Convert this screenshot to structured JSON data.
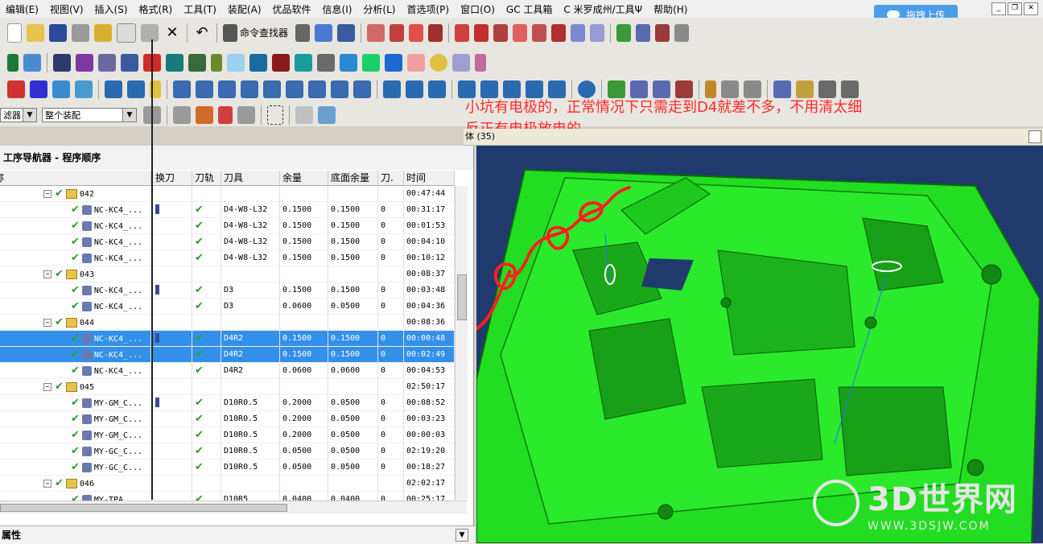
{
  "menu": [
    "编辑(E)",
    "视图(V)",
    "插入(S)",
    "格式(R)",
    "工具(T)",
    "装配(A)",
    "优品软件",
    "信息(I)",
    "分析(L)",
    "首选项(P)",
    "窗口(O)",
    "GC 工具箱",
    "C 米罗成州/工具Ψ",
    "帮助(H)"
  ],
  "upload_button": "拖拽上传",
  "toolbar": {
    "command_finder": "命令查找器"
  },
  "filter": {
    "label": "滤器",
    "assembly": "整个装配"
  },
  "annotation": [
    "小坑有电极的，正常情况下只需走到D4就差不多，不用清太细",
    "反正有电极放电的。"
  ],
  "graphics": {
    "title": "体 (35)"
  },
  "navigator": {
    "title": "工序导航器 - 程序顺序",
    "columns": [
      "名称",
      "换刀",
      "刀轨",
      "刀具",
      "余量",
      "底面余量",
      "刀.",
      "时间"
    ],
    "rows": [
      {
        "type": "group",
        "name": "042",
        "time": "00:47:44"
      },
      {
        "type": "op",
        "name": "NC-KC4_...",
        "tc": true,
        "path": true,
        "tool": "D4-W8-L32",
        "stock": "0.1500",
        "floor": "0.1500",
        "n": "0",
        "time": "00:31:17",
        "sel": false
      },
      {
        "type": "op",
        "name": "NC-KC4_...",
        "tc": false,
        "path": true,
        "tool": "D4-W8-L32",
        "stock": "0.1500",
        "floor": "0.1500",
        "n": "0",
        "time": "00:01:53",
        "sel": false
      },
      {
        "type": "op",
        "name": "NC-KC4_...",
        "tc": false,
        "path": true,
        "tool": "D4-W8-L32",
        "stock": "0.1500",
        "floor": "0.1500",
        "n": "0",
        "time": "00:04:10",
        "sel": false
      },
      {
        "type": "op",
        "name": "NC-KC4_...",
        "tc": false,
        "path": true,
        "tool": "D4-W8-L32",
        "stock": "0.1500",
        "floor": "0.1500",
        "n": "0",
        "time": "00:10:12",
        "sel": false
      },
      {
        "type": "group",
        "name": "043",
        "time": "00:08:37"
      },
      {
        "type": "op",
        "name": "NC-KC4_...",
        "tc": true,
        "path": true,
        "tool": "D3",
        "stock": "0.1500",
        "floor": "0.1500",
        "n": "0",
        "time": "00:03:48",
        "sel": false
      },
      {
        "type": "op",
        "name": "NC-KC4_...",
        "tc": false,
        "path": true,
        "tool": "D3",
        "stock": "0.0600",
        "floor": "0.0500",
        "n": "0",
        "time": "00:04:36",
        "sel": false
      },
      {
        "type": "group",
        "name": "044",
        "time": "00:08:36"
      },
      {
        "type": "op",
        "name": "NC-KC4_...",
        "tc": true,
        "path": true,
        "tool": "D4R2",
        "stock": "0.1500",
        "floor": "0.1500",
        "n": "0",
        "time": "00:00:48",
        "sel": true
      },
      {
        "type": "op",
        "name": "NC-KC4_...",
        "tc": false,
        "path": true,
        "tool": "D4R2",
        "stock": "0.1500",
        "floor": "0.1500",
        "n": "0",
        "time": "00:02:49",
        "sel": true
      },
      {
        "type": "op",
        "name": "NC-KC4_...",
        "tc": false,
        "path": true,
        "tool": "D4R2",
        "stock": "0.0600",
        "floor": "0.0600",
        "n": "0",
        "time": "00:04:53",
        "sel": false
      },
      {
        "type": "group",
        "name": "045",
        "time": "02:50:17"
      },
      {
        "type": "op",
        "name": "MY-GM_C...",
        "tc": true,
        "path": true,
        "tool": "D10R0.5",
        "stock": "0.2000",
        "floor": "0.0500",
        "n": "0",
        "time": "00:08:52",
        "sel": false
      },
      {
        "type": "op",
        "name": "MY-GM_C...",
        "tc": false,
        "path": true,
        "tool": "D10R0.5",
        "stock": "0.2000",
        "floor": "0.0500",
        "n": "0",
        "time": "00:03:23",
        "sel": false
      },
      {
        "type": "op",
        "name": "MY-GM_C...",
        "tc": false,
        "path": true,
        "tool": "D10R0.5",
        "stock": "0.2000",
        "floor": "0.0500",
        "n": "0",
        "time": "00:00:03",
        "sel": false
      },
      {
        "type": "op",
        "name": "MY-GC_C...",
        "tc": false,
        "path": true,
        "tool": "D10R0.5",
        "stock": "0.0500",
        "floor": "0.0500",
        "n": "0",
        "time": "02:19:20",
        "sel": false
      },
      {
        "type": "op",
        "name": "MY-GC_C...",
        "tc": false,
        "path": true,
        "tool": "D10R0.5",
        "stock": "0.0500",
        "floor": "0.0500",
        "n": "0",
        "time": "00:18:27",
        "sel": false
      },
      {
        "type": "group",
        "name": "046",
        "time": "02:02:17"
      },
      {
        "type": "op",
        "name": "MY-TPA",
        "tc": false,
        "path": true,
        "tool": "D10R5",
        "stock": "0.0400",
        "floor": "0.0400",
        "n": "0",
        "time": "00:25:17",
        "sel": false
      }
    ]
  },
  "properties": {
    "title": "属性"
  },
  "watermark": {
    "brand": "3D世界网",
    "url": "WWW.3DSJW.COM"
  },
  "colors": {
    "model_green": "#22dd22",
    "selection_blue": "#3390e8",
    "annotation_red": "#ff2a2a",
    "viewport_bg": "#203a6e"
  },
  "icons": [
    "new-file-icon",
    "open-folder-icon",
    "save-icon",
    "print-icon",
    "cut-icon",
    "copy-icon",
    "paste-icon",
    "delete-icon",
    "undo-icon",
    "binoculars-icon",
    "arrow-icon"
  ]
}
